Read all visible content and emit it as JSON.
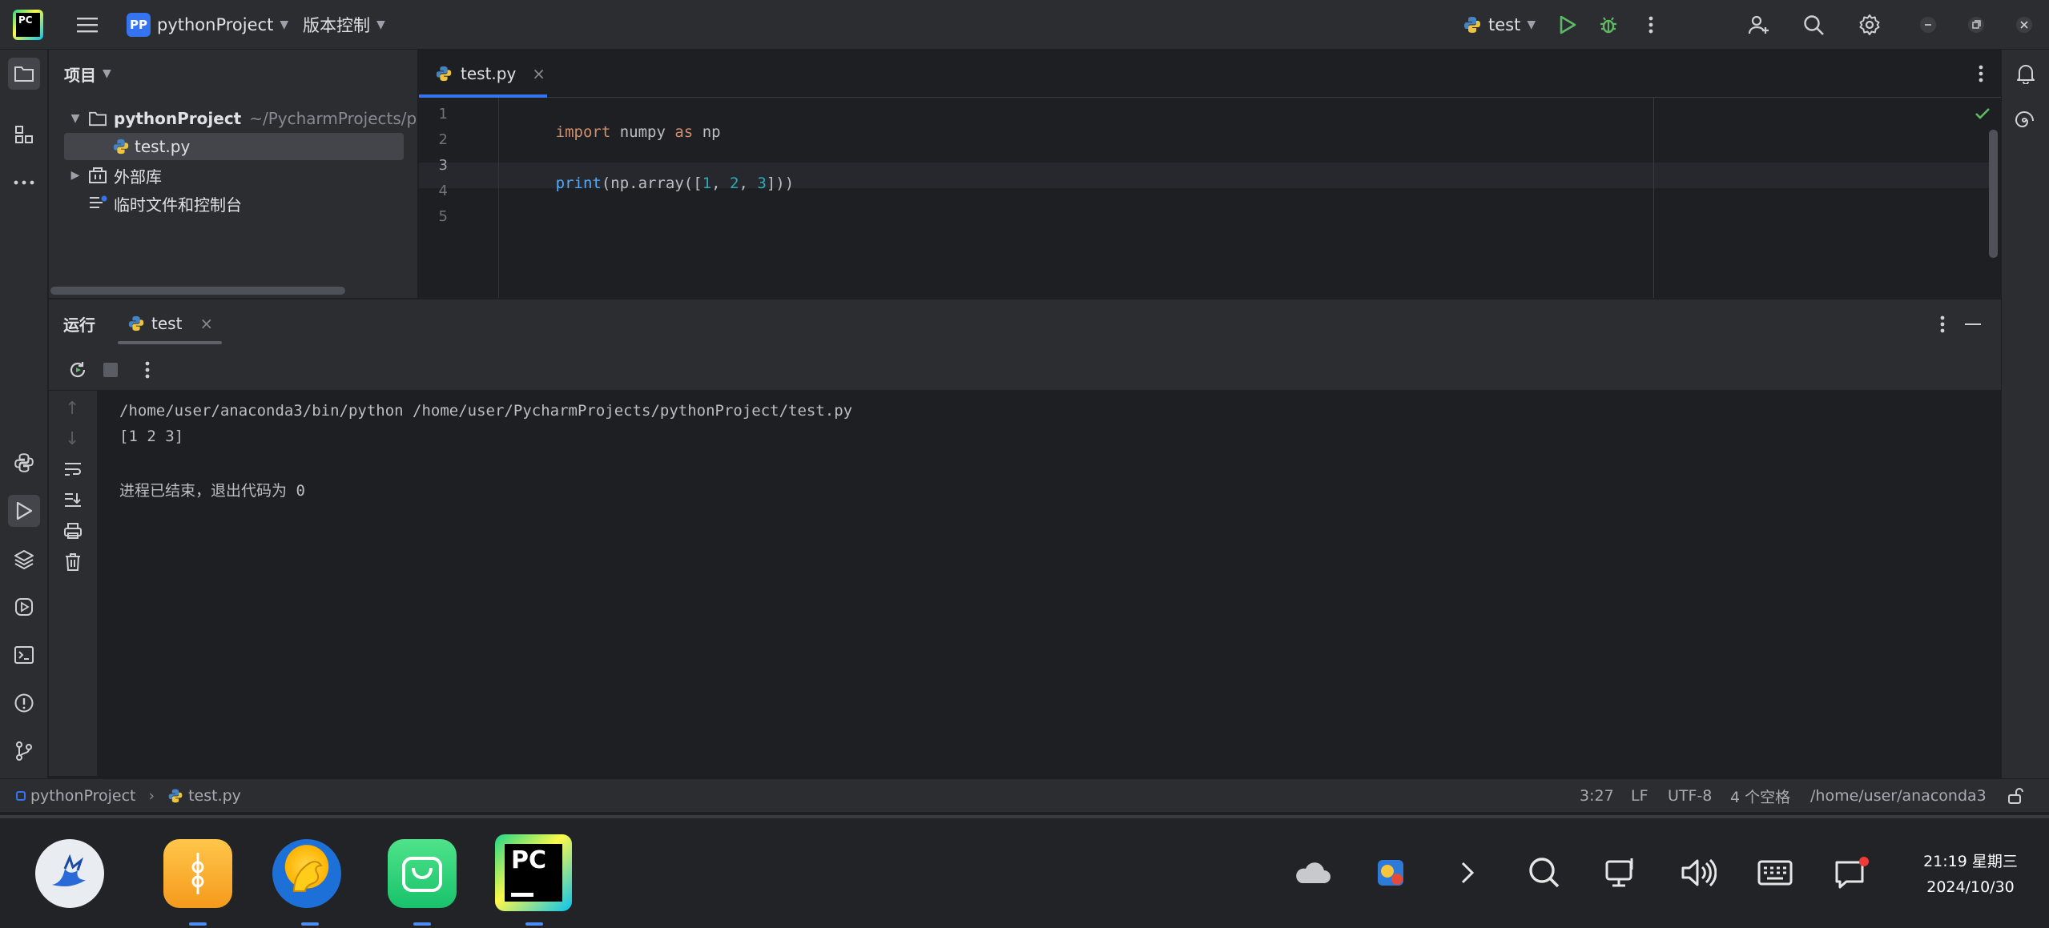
{
  "titlebar": {
    "app_logo": "PC",
    "project_badge": "PP",
    "project_name": "pythonProject",
    "vcs_menu": "版本控制",
    "run_config": "test"
  },
  "project_panel": {
    "title": "项目",
    "tree": [
      {
        "label": "pythonProject",
        "path": "~/PycharmProjects/pythonProject"
      },
      {
        "label": "test.py"
      },
      {
        "label": "外部库"
      },
      {
        "label": "临时文件和控制台"
      }
    ]
  },
  "editor": {
    "tab_label": "test.py",
    "line_numbers": [
      "1",
      "2",
      "3",
      "4",
      "5"
    ],
    "code": {
      "l1_kw": "import",
      "l1_mod": " numpy ",
      "l1_as": "as",
      "l1_alias": " np",
      "l3_fn": "print",
      "l3_open": "(np.array([",
      "l3_n1": "1",
      "l3_c1": ", ",
      "l3_n2": "2",
      "l3_c2": ", ",
      "l3_n3": "3",
      "l3_close": "]))"
    }
  },
  "run_panel": {
    "title": "运行",
    "tab_label": "test",
    "console": [
      "/home/user/anaconda3/bin/python /home/user/PycharmProjects/pythonProject/test.py",
      "[1 2 3]",
      "",
      "进程已结束，退出代码为 0"
    ]
  },
  "statusbar": {
    "breadcrumb_project": "pythonProject",
    "breadcrumb_file": "test.py",
    "position": "3:27",
    "line_ending": "LF",
    "encoding": "UTF-8",
    "indent": "4 个空格",
    "interpreter": "/home/user/anaconda3"
  },
  "taskbar": {
    "pycharm_label": "PC",
    "clock_time": "21:19 星期三",
    "clock_date": "2024/10/30"
  },
  "colors": {
    "accent": "#3574f0",
    "run_green": "#5fb865",
    "keyword": "#cf8e6d",
    "function": "#56a8f5",
    "number": "#2aacb8"
  }
}
